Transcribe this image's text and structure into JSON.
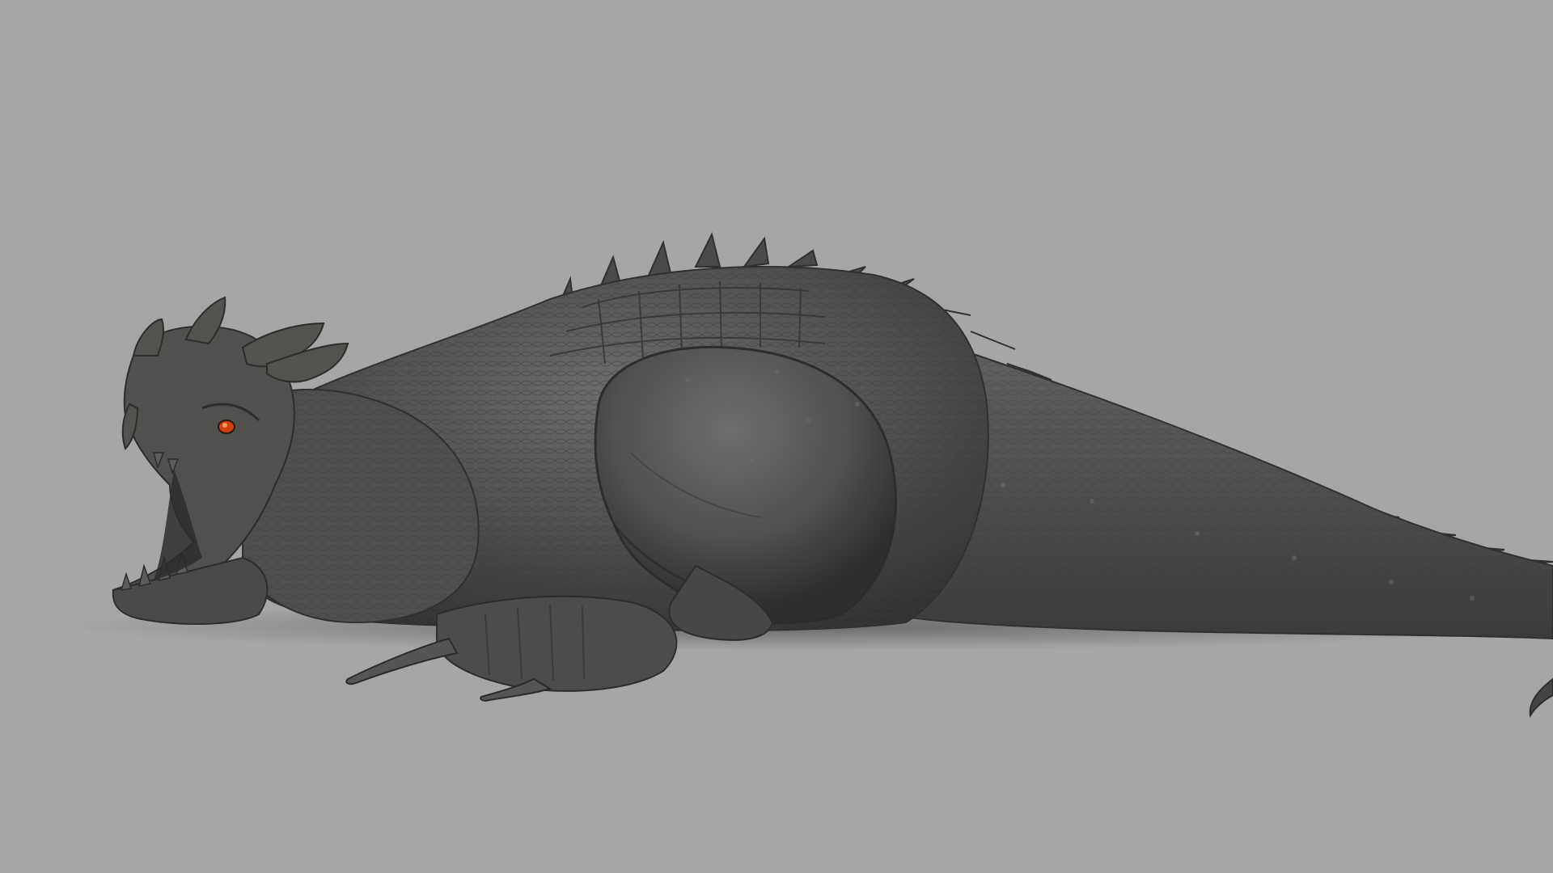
{
  "scene": {
    "background_color": "#a6a6a6",
    "subject": "sculpted-reptile-creature",
    "colors": {
      "clay": "#4e4f4d",
      "clay_light": "#6a6b69",
      "clay_dark": "#2f302f",
      "shadow": "#3a3a3a",
      "eye": "#d04010"
    }
  }
}
